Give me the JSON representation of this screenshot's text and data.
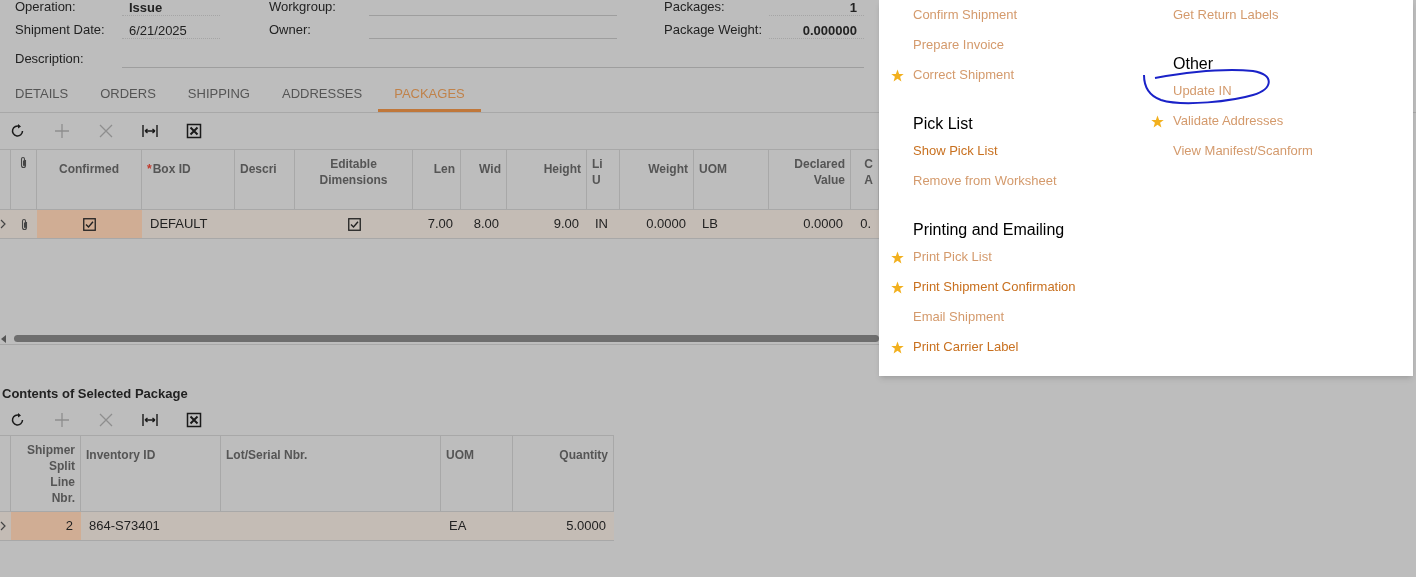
{
  "form": {
    "rows": [
      {
        "fields": [
          {
            "label": "Operation:",
            "value": "Issue",
            "bold": true
          },
          {
            "label": "Workgroup:"
          },
          {
            "label": "Packages:",
            "value": "1",
            "bold": true
          }
        ]
      },
      {
        "fields": [
          {
            "label": "Shipment Date:",
            "value": "6/21/2025",
            "bold": false
          },
          {
            "label": "Owner:"
          },
          {
            "label": "Package Weight:",
            "value": "0.000000",
            "bold": true
          }
        ]
      },
      {
        "fields": [
          {
            "label": "Description:"
          }
        ]
      }
    ]
  },
  "tabs": [
    {
      "label": "DETAILS",
      "selected": false
    },
    {
      "label": "ORDERS",
      "selected": false
    },
    {
      "label": "SHIPPING",
      "selected": false
    },
    {
      "label": "ADDRESSES",
      "selected": false
    },
    {
      "label": "PACKAGES",
      "selected": true
    }
  ],
  "packages": {
    "toolbar": [
      {
        "kind": "refresh",
        "disabled": false
      },
      {
        "kind": "add",
        "disabled": true
      },
      {
        "kind": "delete",
        "disabled": true
      },
      {
        "kind": "fit",
        "disabled": false
      },
      {
        "kind": "export",
        "disabled": false
      }
    ],
    "columns": [
      {
        "kind": "settings"
      },
      {
        "kind": "attach"
      },
      {
        "kind": "text",
        "header": "Confirmed"
      },
      {
        "kind": "text",
        "header": "Box ID",
        "required_mark": "*"
      },
      {
        "kind": "text",
        "header": "Descri"
      },
      {
        "kind": "text",
        "header": "Editable\nDimensions"
      },
      {
        "kind": "text",
        "header": "Len"
      },
      {
        "kind": "text",
        "header": "Wid"
      },
      {
        "kind": "text",
        "header": "Height"
      },
      {
        "kind": "text",
        "header": "Li\nU"
      },
      {
        "kind": "text",
        "header": "Weight"
      },
      {
        "kind": "text",
        "header": "UOM"
      },
      {
        "kind": "text",
        "header": "Declared\nValue"
      },
      {
        "kind": "text",
        "header": "C\nA"
      }
    ],
    "rows": [
      {
        "selected": true,
        "cells": [
          {
            "kind": "row_arrow"
          },
          {
            "kind": "attachment"
          },
          {
            "kind": "checkbox",
            "checked": true,
            "active": true
          },
          {
            "kind": "text",
            "text": "DEFAULT",
            "active": false
          },
          {
            "kind": "empty",
            "active": false
          },
          {
            "kind": "checkbox",
            "checked": true,
            "active": false
          },
          {
            "kind": "text",
            "text": "7.00",
            "active": false
          },
          {
            "kind": "text",
            "text": "8.00",
            "active": false
          },
          {
            "kind": "text",
            "text": "9.00",
            "active": false
          },
          {
            "kind": "text",
            "text": "IN",
            "active": false
          },
          {
            "kind": "text",
            "text": "0.0000",
            "active": false
          },
          {
            "kind": "text",
            "text": "LB",
            "active": false
          },
          {
            "kind": "text",
            "text": "0.0000",
            "active": false
          },
          {
            "kind": "text",
            "text": "0.",
            "active": false
          }
        ]
      }
    ]
  },
  "contents": {
    "title": "Contents of Selected Package",
    "toolbar": [
      {
        "kind": "refresh",
        "disabled": false
      },
      {
        "kind": "add",
        "disabled": true
      },
      {
        "kind": "delete",
        "disabled": true
      },
      {
        "kind": "fit",
        "disabled": false
      },
      {
        "kind": "export",
        "disabled": false
      }
    ],
    "columns": [
      {
        "kind": "settings"
      },
      {
        "kind": "text",
        "header": "Shipmer\nSplit\nLine\nNbr."
      },
      {
        "kind": "text",
        "header": "Inventory ID"
      },
      {
        "kind": "text",
        "header": "Lot/Serial Nbr."
      },
      {
        "kind": "text",
        "header": "UOM"
      },
      {
        "kind": "text",
        "header": "Quantity"
      }
    ],
    "rows": [
      {
        "selected": true,
        "cells": [
          {
            "kind": "row_arrow"
          },
          {
            "kind": "text",
            "text": "2",
            "active": true
          },
          {
            "kind": "text",
            "text": "864-S73401",
            "active": false
          },
          {
            "kind": "empty",
            "active": false
          },
          {
            "kind": "text",
            "text": "EA",
            "active": false
          },
          {
            "kind": "text",
            "text": "5.0000",
            "active": false
          }
        ]
      }
    ]
  },
  "menu": {
    "columns": [
      {
        "groups": [
          {
            "items": [
              {
                "label": "Confirm Shipment",
                "starred": false,
                "disabled": true
              },
              {
                "label": "Prepare Invoice",
                "starred": false,
                "disabled": true
              },
              {
                "label": "Correct Shipment",
                "starred": true,
                "disabled": true
              }
            ]
          },
          {
            "title": "Pick List",
            "items": [
              {
                "label": "Show Pick List",
                "starred": false,
                "disabled": false
              },
              {
                "label": "Remove from Worksheet",
                "starred": false,
                "disabled": true
              }
            ]
          },
          {
            "title": "Printing and Emailing",
            "items": [
              {
                "label": "Print Pick List",
                "starred": true,
                "disabled": true
              },
              {
                "label": "Print Shipment Confirmation",
                "starred": true,
                "disabled": false
              },
              {
                "label": "Email Shipment",
                "starred": false,
                "disabled": true
              },
              {
                "label": "Print Carrier Label",
                "starred": true,
                "disabled": false
              }
            ]
          }
        ]
      },
      {
        "groups": [
          {
            "items": [
              {
                "label": "Get Return Labels",
                "starred": false,
                "disabled": true
              }
            ]
          },
          {
            "title": "Other",
            "items": [
              {
                "label": "Update IN",
                "starred": false,
                "disabled": true
              },
              {
                "label": "Validate Addresses",
                "starred": true,
                "disabled": true
              },
              {
                "label": "View Manifest/Scanform",
                "starred": false,
                "disabled": true
              }
            ]
          }
        ]
      }
    ]
  }
}
